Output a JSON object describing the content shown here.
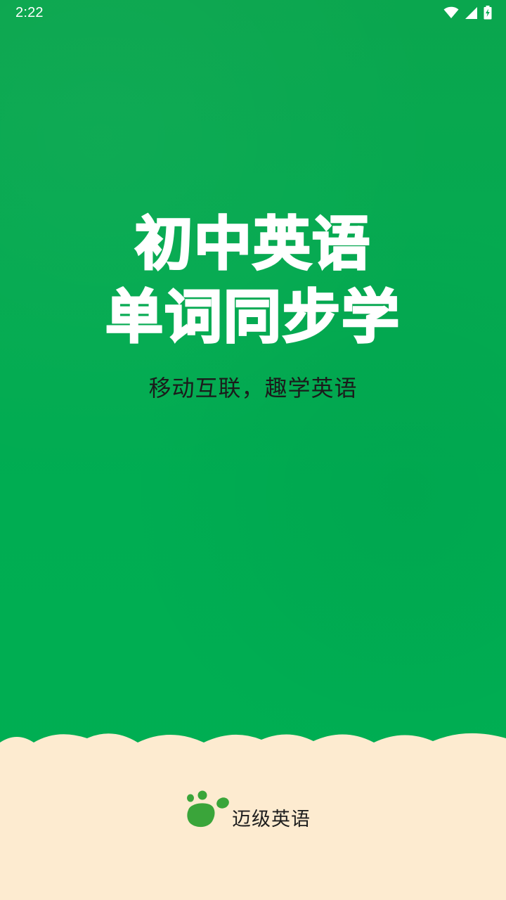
{
  "status_bar": {
    "time": "2:22",
    "icons": [
      "wifi-icon",
      "cell-signal-icon",
      "battery-charging-icon"
    ]
  },
  "splash": {
    "title_line_1": "初中英语",
    "title_line_2": "单词同步学",
    "subtitle": "移动互联，趣学英语"
  },
  "brand": {
    "name": "迈级英语",
    "logo_icon": "paw-print-icon"
  },
  "colors": {
    "background_green": "#00ad52",
    "footer_cream": "#fdebd0",
    "logo_green": "#3aa53a",
    "title_text": "#ffffff",
    "subtitle_text": "#1b1b1b"
  }
}
